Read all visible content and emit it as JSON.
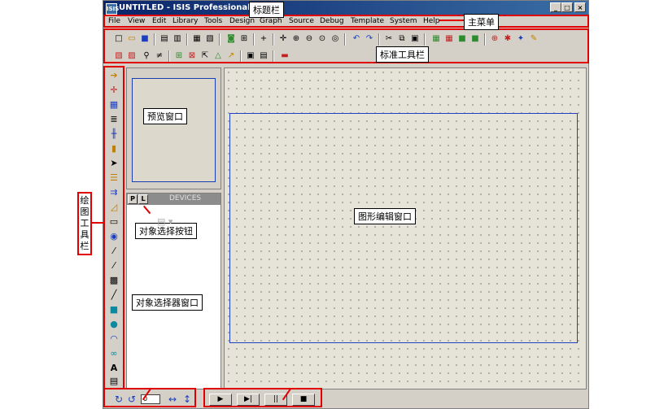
{
  "window": {
    "title": "UNTITLED - ISIS Professional",
    "app_icon_text": "ISIS",
    "buttons": {
      "minimize": "_",
      "restore": "□",
      "close": "×"
    }
  },
  "menu": [
    "File",
    "View",
    "Edit",
    "Library",
    "Tools",
    "Design",
    "Graph",
    "Source",
    "Debug",
    "Template",
    "System",
    "Help"
  ],
  "annotations": {
    "title_bar": "标题栏",
    "main_menu": "主菜单",
    "standard_toolbar": "标准工具栏",
    "preview_window": "预览窗口",
    "object_select_button": "对象选择按钮",
    "object_selector_window": "对象选择器窗口",
    "graphics_edit_window": "图形编辑窗口",
    "drawing_toolbar": "绘图工具栏"
  },
  "selector": {
    "p_button": "P",
    "l_button": "L",
    "title": "DEVICES"
  },
  "bottom": {
    "rotation_value": "0",
    "sim_play": "▶",
    "sim_step": "▶|",
    "sim_pause": "||",
    "sim_stop": "■"
  },
  "colors": {
    "titlebar": "#0a246a",
    "annotation_red": "#e00000",
    "sheet_border": "#2340c0",
    "canvas": "#e6e4d8"
  }
}
